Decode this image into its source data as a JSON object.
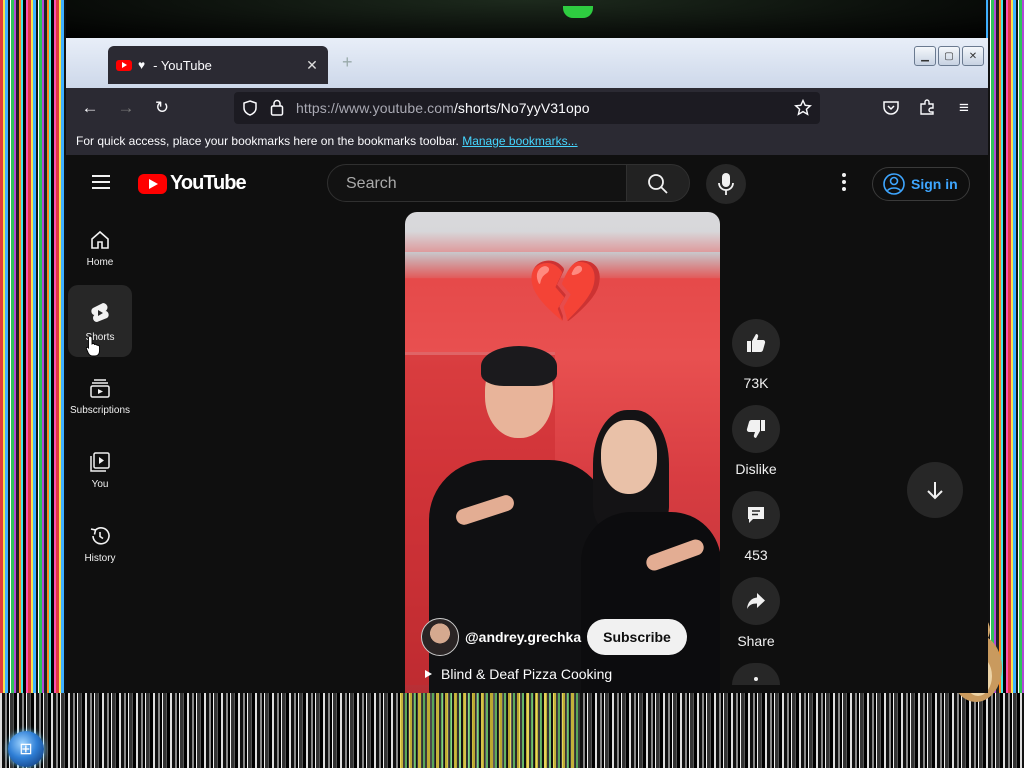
{
  "browser": {
    "tab_title": "- YouTube",
    "url_host": "https://www.youtube.com",
    "url_path": "/shorts/No7yyV31opo",
    "bookmarks_text": "For quick access, place your bookmarks here on the bookmarks toolbar.",
    "bookmarks_link": "Manage bookmarks..."
  },
  "youtube": {
    "logo_text": "YouTube",
    "search_placeholder": "Search",
    "sign_in": "Sign in",
    "guide": [
      {
        "label": "Home"
      },
      {
        "label": "Shorts"
      },
      {
        "label": "Subscriptions"
      },
      {
        "label": "You"
      },
      {
        "label": "History"
      }
    ],
    "short": {
      "channel_handle": "@andrey.grechka",
      "subscribe_label": "Subscribe",
      "title": "Blind & Deaf Pizza Cooking",
      "heart_emoji": "💔"
    },
    "actions": {
      "like_count": "73K",
      "dislike_label": "Dislike",
      "comment_count": "453",
      "share_label": "Share"
    }
  },
  "colors": {
    "yt_bg": "#0f0f0f",
    "yt_red": "#ff0000",
    "link_blue": "#3ea6ff",
    "firefox_toolbar": "#2b2a33"
  }
}
